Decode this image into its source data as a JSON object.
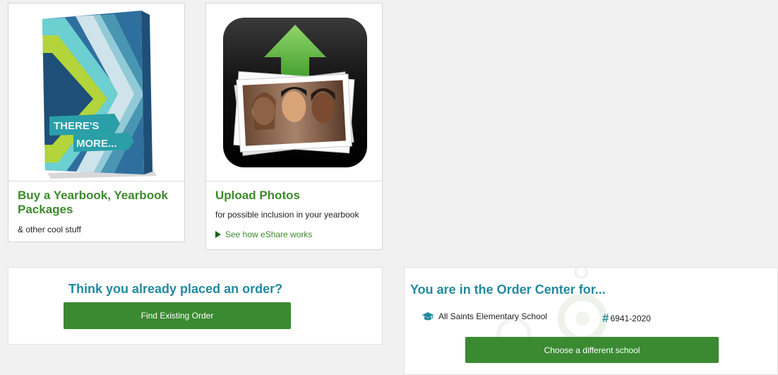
{
  "cards": {
    "yearbook": {
      "title_line1": "Buy a Yearbook, Yearbook",
      "title_line2": "Packages",
      "subtitle": "& other cool stuff",
      "cover_text_1": "THERE'S",
      "cover_text_2": "MORE..."
    },
    "upload": {
      "title": "Upload Photos",
      "subtitle": "for possible inclusion in your yearbook",
      "link": "See how eShare works"
    }
  },
  "order": {
    "heading": "Think you already placed an order?",
    "button": "Find Existing Order"
  },
  "center": {
    "heading": "You are in the Order Center for...",
    "school_icon": "graduation-cap-icon",
    "school_name": "All Saints Elementary School",
    "hash": "#",
    "school_number": "6941-2020",
    "button": "Choose a different school"
  },
  "colors": {
    "green": "#3a8a32",
    "title_green": "#3d8a2c",
    "teal": "#238a9e",
    "background": "#f1f1f1"
  }
}
